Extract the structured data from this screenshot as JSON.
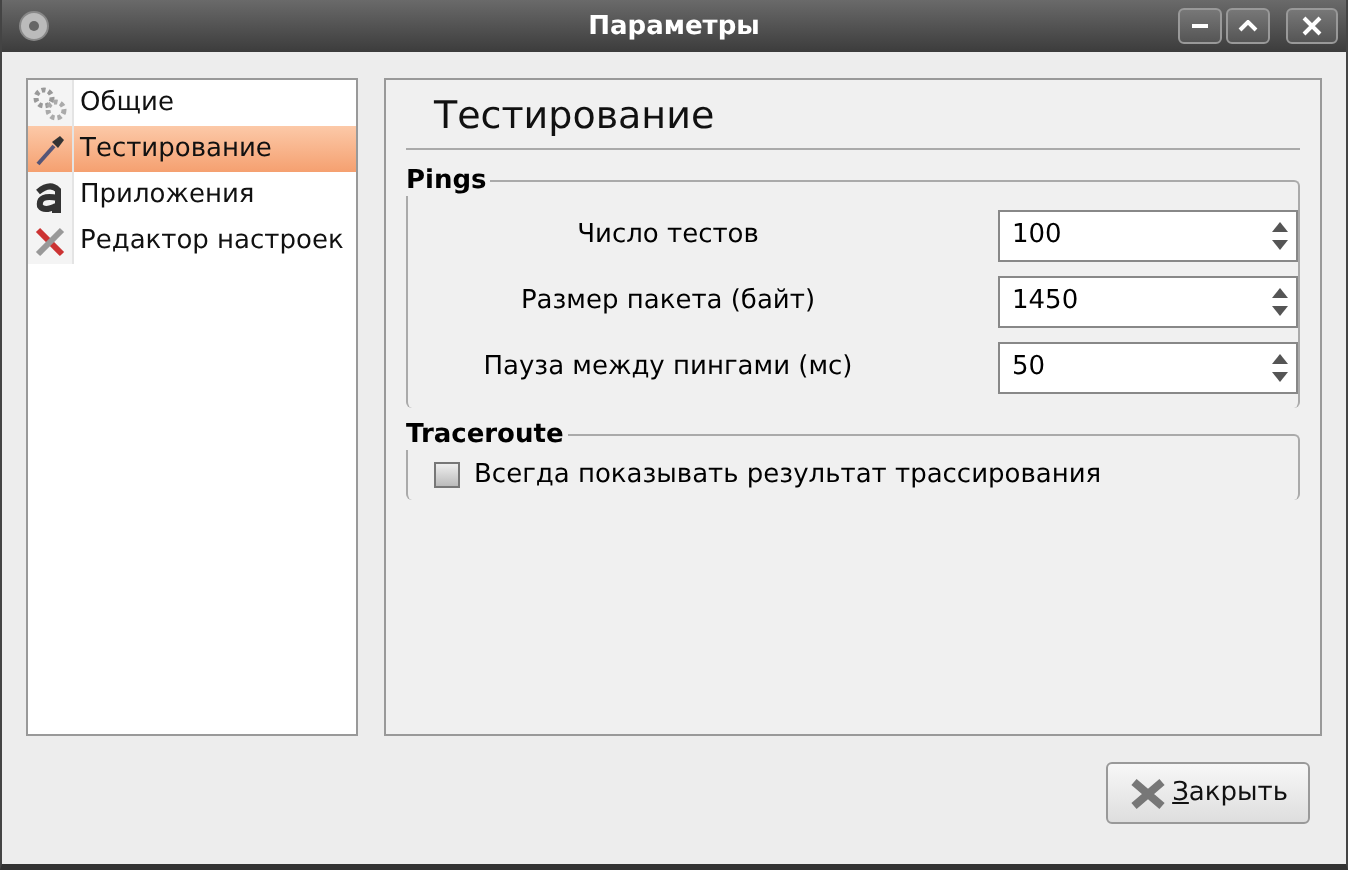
{
  "window": {
    "title": "Параметры"
  },
  "sidebar": {
    "items": [
      {
        "label": "Общие",
        "selected": false
      },
      {
        "label": "Тестирование",
        "selected": true
      },
      {
        "label": "Приложения",
        "selected": false
      },
      {
        "label": "Редактор настроек",
        "selected": false
      }
    ]
  },
  "page": {
    "title": "Тестирование",
    "groups": [
      {
        "title": "Pings",
        "rows": [
          {
            "kind": "spin",
            "label": "Число тестов",
            "value": "100"
          },
          {
            "kind": "spin",
            "label": "Размер пакета (байт)",
            "value": "1450"
          },
          {
            "kind": "spin",
            "label": "Пауза между пингами (мс)",
            "value": "50"
          }
        ]
      },
      {
        "title": "Traceroute",
        "rows": [
          {
            "kind": "checkbox",
            "label": "Всегда показывать результат трассирования",
            "checked": false
          }
        ]
      }
    ]
  },
  "buttons": [
    {
      "label": "Закрыть",
      "mnemonic_underlined": true
    }
  ]
}
